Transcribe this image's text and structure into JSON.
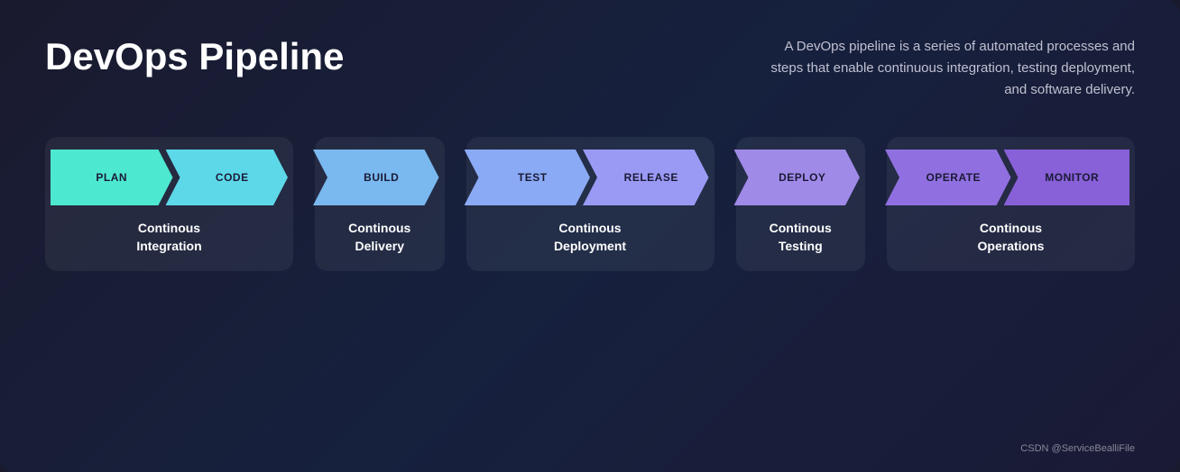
{
  "title": "DevOps Pipeline",
  "description": "A DevOps pipeline is a series of automated processes and steps that enable continuous integration, testing deployment, and software delivery.",
  "pipeline": {
    "stages": [
      {
        "id": "plan",
        "label": "PLAN",
        "color": "#4de8d0",
        "group": 0
      },
      {
        "id": "code",
        "label": "CODE",
        "color": "#5dd8e8",
        "group": 0
      },
      {
        "id": "build",
        "label": "BUILD",
        "color": "#7ab8f0",
        "group": 1
      },
      {
        "id": "test",
        "label": "TEST",
        "color": "#8aaaf5",
        "group": 2
      },
      {
        "id": "release",
        "label": "RELEASE",
        "color": "#9a9af5",
        "group": 2
      },
      {
        "id": "deploy",
        "label": "DEPLOY",
        "color": "#a08ae8",
        "group": 3
      },
      {
        "id": "operate",
        "label": "OPERATE",
        "color": "#9070e0",
        "group": 4
      },
      {
        "id": "monitor",
        "label": "MONITOR",
        "color": "#8860d8",
        "group": 4
      }
    ],
    "groups": [
      {
        "id": "ci",
        "label": "Continous\nIntegration",
        "spans": [
          0,
          1
        ]
      },
      {
        "id": "cd",
        "label": "Continous\nDelivery",
        "spans": [
          2,
          2
        ]
      },
      {
        "id": "cdep",
        "label": "Continous\nDeployment",
        "spans": [
          3,
          4
        ]
      },
      {
        "id": "ct",
        "label": "Continous\nTesting",
        "spans": [
          5,
          5
        ]
      },
      {
        "id": "co",
        "label": "Continous\nOperations",
        "spans": [
          6,
          7
        ]
      }
    ]
  },
  "footer": {
    "credit": "CSDN @ServiceBealliFile"
  }
}
